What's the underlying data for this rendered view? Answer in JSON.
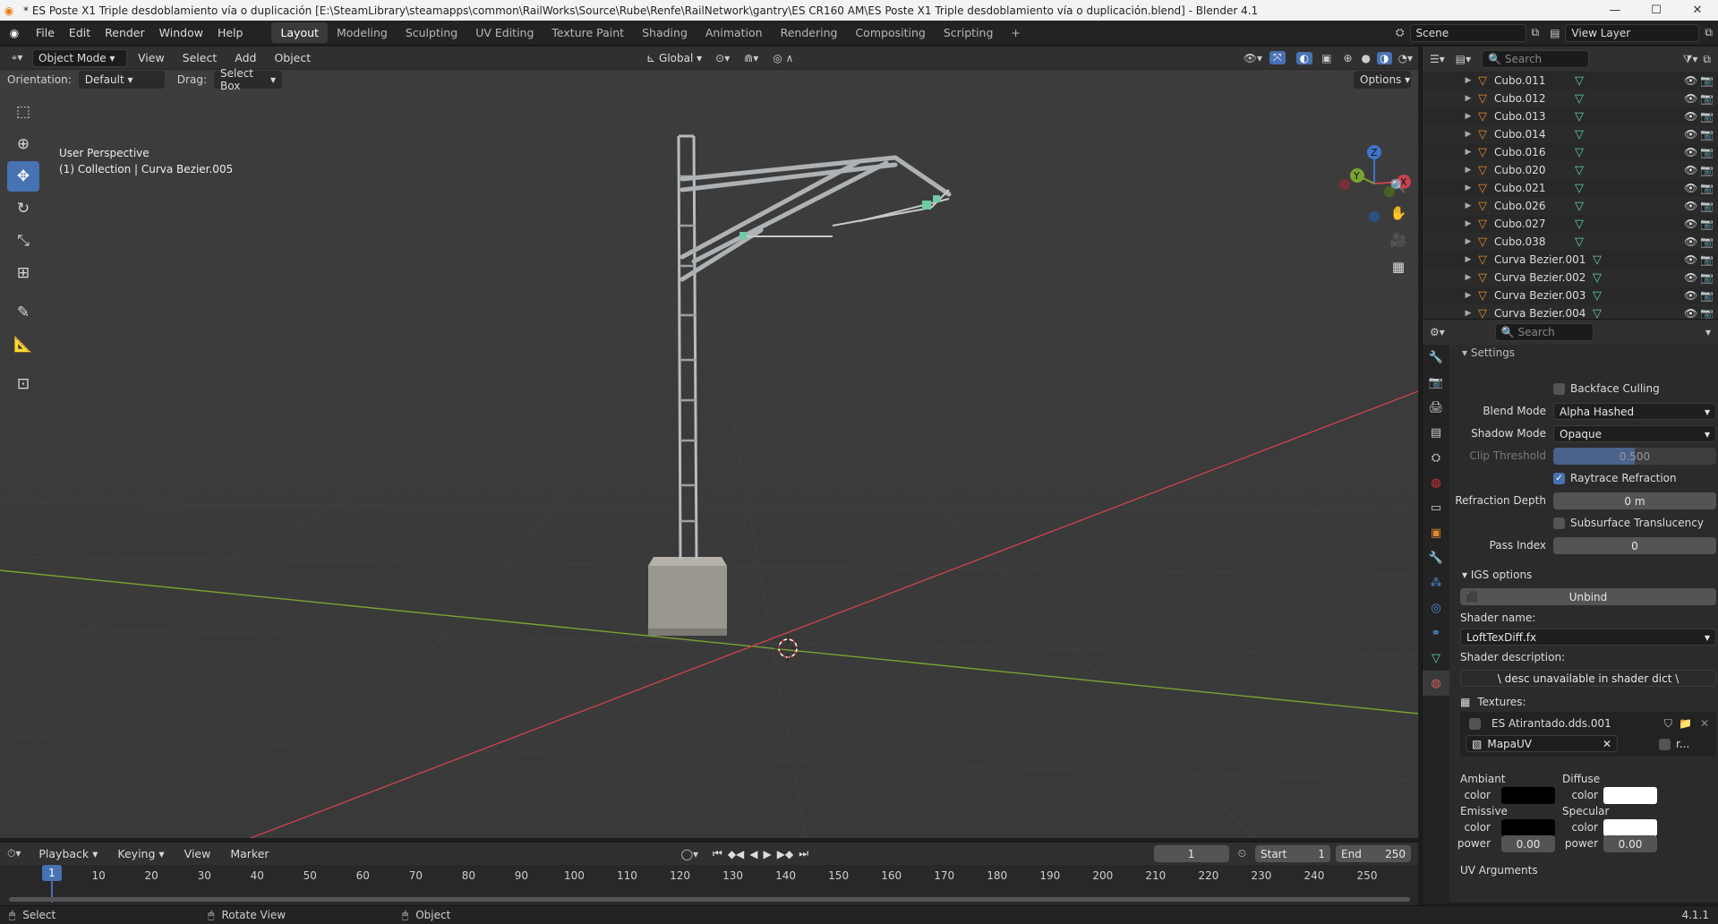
{
  "window": {
    "title": "* ES Poste X1 Triple desdoblamiento vía o duplicación [E:\\SteamLibrary\\steamapps\\common\\RailWorks\\Source\\Rube\\Renfe\\RailNetwork\\gantry\\ES CR160 AM\\ES Poste X1 Triple desdoblamiento vía o duplicación.blend] - Blender 4.1",
    "minimize": "—",
    "maximize": "☐",
    "close": "✕"
  },
  "menu": [
    "File",
    "Edit",
    "Render",
    "Window",
    "Help"
  ],
  "workspaces": [
    "Layout",
    "Modeling",
    "Sculpting",
    "UV Editing",
    "Texture Paint",
    "Shading",
    "Animation",
    "Rendering",
    "Compositing",
    "Scripting"
  ],
  "active_workspace": "Layout",
  "add_workspace": "+",
  "scene": {
    "name": "Scene",
    "view_layer": "View Layer"
  },
  "viewport_header": {
    "mode": "Object Mode",
    "menus": [
      "View",
      "Select",
      "Add",
      "Object"
    ],
    "transform_orientation": "Global",
    "options": "Options"
  },
  "tool_settings": {
    "orientation_label": "Orientation:",
    "orientation_value": "Default",
    "drag_label": "Drag:",
    "drag_value": "Select Box"
  },
  "viewport_info": {
    "line1": "User Perspective",
    "line2": "(1) Collection | Curva Bezier.005"
  },
  "toolbar": [
    {
      "name": "select-box-tool",
      "icon": "select-box-icon",
      "glyph": "⬚",
      "active": false
    },
    {
      "name": "cursor-tool",
      "icon": "cursor-icon",
      "glyph": "⊕",
      "active": false
    },
    {
      "name": "move-tool",
      "icon": "move-icon",
      "glyph": "✥",
      "active": true
    },
    {
      "name": "rotate-tool",
      "icon": "rotate-icon",
      "glyph": "↻",
      "active": false
    },
    {
      "name": "scale-tool",
      "icon": "scale-icon",
      "glyph": "⤡",
      "active": false
    },
    {
      "name": "transform-tool",
      "icon": "transform-icon",
      "glyph": "⊞",
      "active": false
    },
    {
      "name": "annotate-tool",
      "icon": "annotate-icon",
      "glyph": "✎",
      "active": false
    },
    {
      "name": "measure-tool",
      "icon": "measure-icon",
      "glyph": "📐",
      "active": false
    },
    {
      "name": "add-cube-tool",
      "icon": "add-cube-icon",
      "glyph": "⊡",
      "active": false
    }
  ],
  "gizmo_axes": {
    "x": "X",
    "y": "Y",
    "z": "Z"
  },
  "outliner": {
    "search_placeholder": "Search",
    "items": [
      "Cubo.011",
      "Cubo.012",
      "Cubo.013",
      "Cubo.014",
      "Cubo.016",
      "Cubo.020",
      "Cubo.021",
      "Cubo.026",
      "Cubo.027",
      "Cubo.038",
      "Curva Bezier.001",
      "Curva Bezier.002",
      "Curva Bezier.003",
      "Curva Bezier.004"
    ]
  },
  "properties": {
    "search_placeholder": "Search",
    "section_settings": "Settings",
    "backface_culling": "Backface Culling",
    "blend_mode_label": "Blend Mode",
    "blend_mode_value": "Alpha Hashed",
    "shadow_mode_label": "Shadow Mode",
    "shadow_mode_value": "Opaque",
    "clip_threshold_label": "Clip Threshold",
    "clip_threshold_value": "0.500",
    "raytrace_refraction": "Raytrace Refraction",
    "refraction_depth_label": "Refraction Depth",
    "refraction_depth_value": "0 m",
    "subsurface_translucency": "Subsurface Translucency",
    "pass_index_label": "Pass Index",
    "pass_index_value": "0",
    "igs_options": "IGS options",
    "unbind": "Unbind",
    "shader_name_label": "Shader name:",
    "shader_name_value": "LoftTexDiff.fx",
    "shader_description_label": "Shader description:",
    "shader_description_value": "\\ desc unavailable in shader dict \\",
    "textures_label": "Textures:",
    "texture_name": "ES Atirantado.dds.001",
    "uv_map": "MapaUV",
    "uv_extra": "r...",
    "ambient_label": "Ambiant",
    "diffuse_label": "Diffuse",
    "emissive_label": "Emissive",
    "specular_label": "Specular",
    "color_label": "color",
    "power_label": "power",
    "emissive_power": "0.00",
    "specular_power": "0.00",
    "ambient_color": "#000000",
    "diffuse_color": "#ffffff",
    "emissive_color": "#000000",
    "specular_color": "#ffffff",
    "uv_arguments": "UV Arguments"
  },
  "timeline": {
    "menus": [
      "Playback",
      "Keying",
      "View",
      "Marker"
    ],
    "current_frame": "1",
    "start_label": "Start",
    "start_value": "1",
    "end_label": "End",
    "end_value": "250",
    "ticks": [
      "1",
      "10",
      "20",
      "30",
      "40",
      "50",
      "60",
      "70",
      "80",
      "90",
      "100",
      "110",
      "120",
      "130",
      "140",
      "150",
      "160",
      "170",
      "180",
      "190",
      "200",
      "210",
      "220",
      "230",
      "240",
      "250"
    ]
  },
  "statusbar": {
    "select": "Select",
    "rotate": "Rotate View",
    "object": "Object",
    "version": "4.1.1"
  },
  "colors": {
    "accent": "#4772b3",
    "x_axis": "#c6434f",
    "y_axis": "#7aa331",
    "z_axis": "#3f74c9",
    "object_orange": "#e28a2e",
    "mesh_green": "#62d39c"
  }
}
